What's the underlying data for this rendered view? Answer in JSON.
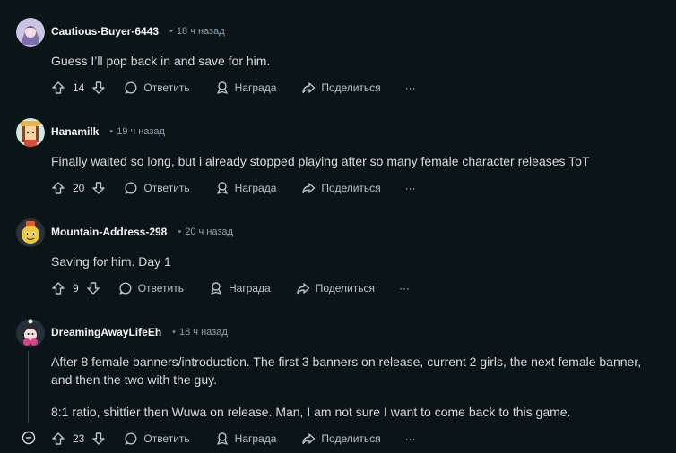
{
  "comments": [
    {
      "username": "Cautious-Buyer-6443",
      "time": "18 ч назад",
      "text": [
        "Guess I’ll pop back in and save for him."
      ],
      "votes": "14",
      "reply_label": "Ответить",
      "award_label": "Награда",
      "share_label": "Поделиться",
      "more_label": "···"
    },
    {
      "username": "Hanamilk",
      "time": "19 ч назад",
      "text": [
        "Finally waited so long, but i already stopped playing after so many female character releases ToT"
      ],
      "votes": "20",
      "reply_label": "Ответить",
      "award_label": "Награда",
      "share_label": "Поделиться",
      "more_label": "···"
    },
    {
      "username": "Mountain-Address-298",
      "time": "20 ч назад",
      "text": [
        "Saving for him. Day 1"
      ],
      "votes": "9",
      "reply_label": "Ответить",
      "award_label": "Награда",
      "share_label": "Поделиться",
      "more_label": "···"
    },
    {
      "username": "DreamingAwayLifeEh",
      "time": "18 ч назад",
      "text": [
        "After 8 female banners/introduction. The first 3 banners on release, current 2 girls, the next female banner, and then the two with the guy.",
        "8:1 ratio, shittier then Wuwa on release. Man, I am not sure I want to come back to this game."
      ],
      "votes": "23",
      "reply_label": "Ответить",
      "award_label": "Награда",
      "share_label": "Поделиться",
      "more_label": "···"
    }
  ],
  "colors": {
    "background": "#0b1416",
    "text": "#d7dadc",
    "muted": "#8ba2ad"
  }
}
